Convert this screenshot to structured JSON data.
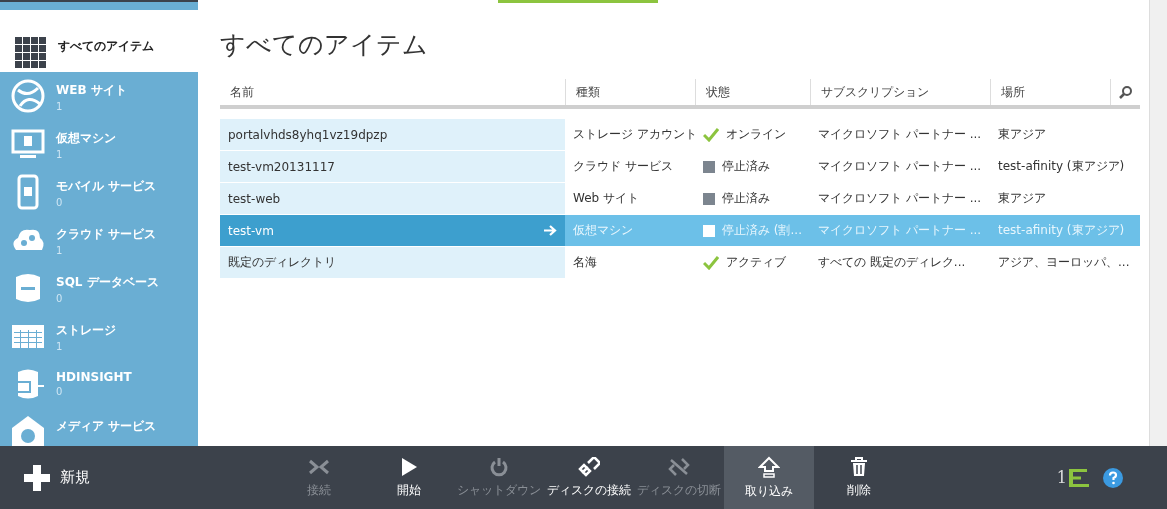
{
  "sidebar": {
    "items": [
      {
        "label": "すべてのアイテム",
        "selected": true
      },
      {
        "label": "WEB サイト",
        "count": "1",
        "selected": false
      },
      {
        "label": "仮想マシン",
        "count": "1",
        "selected": false
      },
      {
        "label": "モバイル サービス",
        "count": "0",
        "selected": false
      },
      {
        "label": "クラウド サービス",
        "count": "1",
        "selected": false
      },
      {
        "label": "SQL データベース",
        "count": "0",
        "selected": false
      },
      {
        "label": "ストレージ",
        "count": "1",
        "selected": false
      },
      {
        "label": "HDINSIGHT",
        "count": "0",
        "selected": false
      },
      {
        "label": "メディア サービス",
        "selected": false
      }
    ]
  },
  "page": {
    "title": "すべてのアイテム"
  },
  "table": {
    "columns": [
      "名前",
      "種類",
      "状態",
      "サブスクリプション",
      "場所"
    ],
    "rows": [
      {
        "name": "portalvhds8yhq1vz19dpzp",
        "type": "ストレージ アカウント",
        "status": {
          "kind": "ok",
          "text": "オンライン"
        },
        "subscription": "マイクロソフト パートナー ...",
        "location": "東アジア",
        "selected": false
      },
      {
        "name": "test-vm20131117",
        "type": "クラウド サービス",
        "status": {
          "kind": "stopped",
          "text": "停止済み"
        },
        "subscription": "マイクロソフト パートナー ...",
        "location": "test-afinity (東アジア)",
        "selected": false
      },
      {
        "name": "test-web",
        "type": "Web サイト",
        "status": {
          "kind": "stopped",
          "text": "停止済み"
        },
        "subscription": "マイクロソフト パートナー ...",
        "location": "東アジア",
        "selected": false
      },
      {
        "name": "test-vm",
        "type": "仮想マシン",
        "status": {
          "kind": "stopped",
          "text": "停止済み (割..."
        },
        "subscription": "マイクロソフト パートナー ...",
        "location": "test-afinity (東アジア)",
        "selected": true
      },
      {
        "name": "既定のディレクトリ",
        "type": "名海",
        "status": {
          "kind": "ok",
          "text": "アクティブ"
        },
        "subscription": "すべての 既定のディレク...",
        "location": "アジア、ヨーロッパ、...",
        "selected": false
      }
    ]
  },
  "command_bar": {
    "new_label": "新規",
    "actions": [
      {
        "kind": "connect",
        "label": "接続",
        "disabled": true,
        "selected": false
      },
      {
        "kind": "start",
        "label": "開始",
        "disabled": false,
        "selected": false
      },
      {
        "kind": "shutdown",
        "label": "シャットダウン",
        "disabled": true,
        "selected": false
      },
      {
        "kind": "attach",
        "label": "ディスクの接続",
        "disabled": false,
        "selected": false
      },
      {
        "kind": "detach",
        "label": "ディスクの切断",
        "disabled": true,
        "selected": false
      },
      {
        "kind": "capture",
        "label": "取り込み",
        "disabled": false,
        "selected": true
      },
      {
        "kind": "delete",
        "label": "削除",
        "disabled": false,
        "selected": false
      }
    ],
    "notification_count": "1"
  }
}
